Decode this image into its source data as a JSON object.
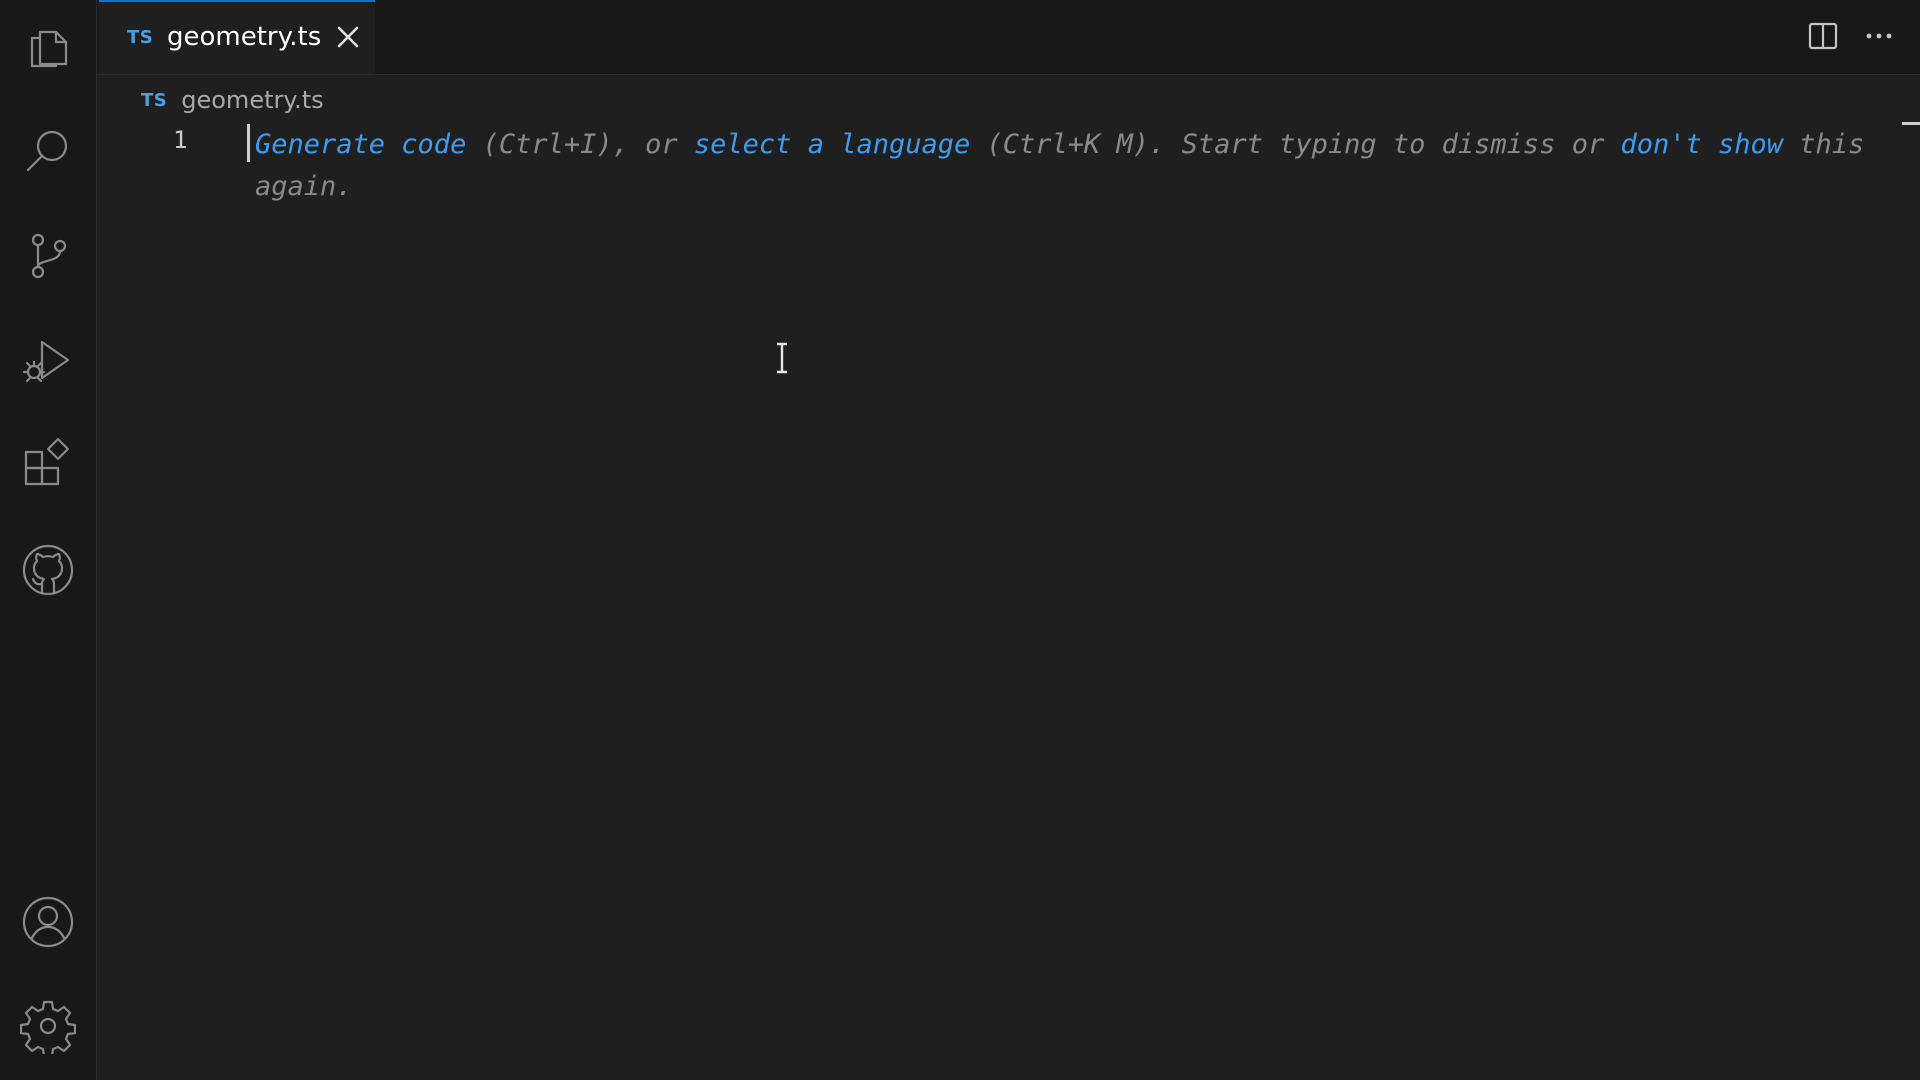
{
  "activity_bar": {
    "icons": [
      "explorer-icon",
      "search-icon",
      "source-control-icon",
      "run-debug-icon",
      "extensions-icon",
      "github-icon",
      "account-icon",
      "settings-gear-icon"
    ]
  },
  "tab": {
    "badge": "TS",
    "label": "geometry.ts"
  },
  "toolbar": {
    "icons": [
      "split-editor-icon",
      "more-actions-icon"
    ]
  },
  "breadcrumb": {
    "badge": "TS",
    "label": "geometry.ts"
  },
  "editor": {
    "line_number": "1",
    "hint": {
      "generate_code": "Generate code",
      "text_1": " (Ctrl+I), or ",
      "select_language": "select a language",
      "text_2": " (Ctrl+K M). Start typing to dismiss or ",
      "dont_show": "don't show",
      "text_3": " this again."
    }
  },
  "colors": {
    "link": "#3e9cf0",
    "hint_text": "#8a8a8a",
    "tab_accent": "#0078d4",
    "ts_badge": "#4aa0e6"
  }
}
